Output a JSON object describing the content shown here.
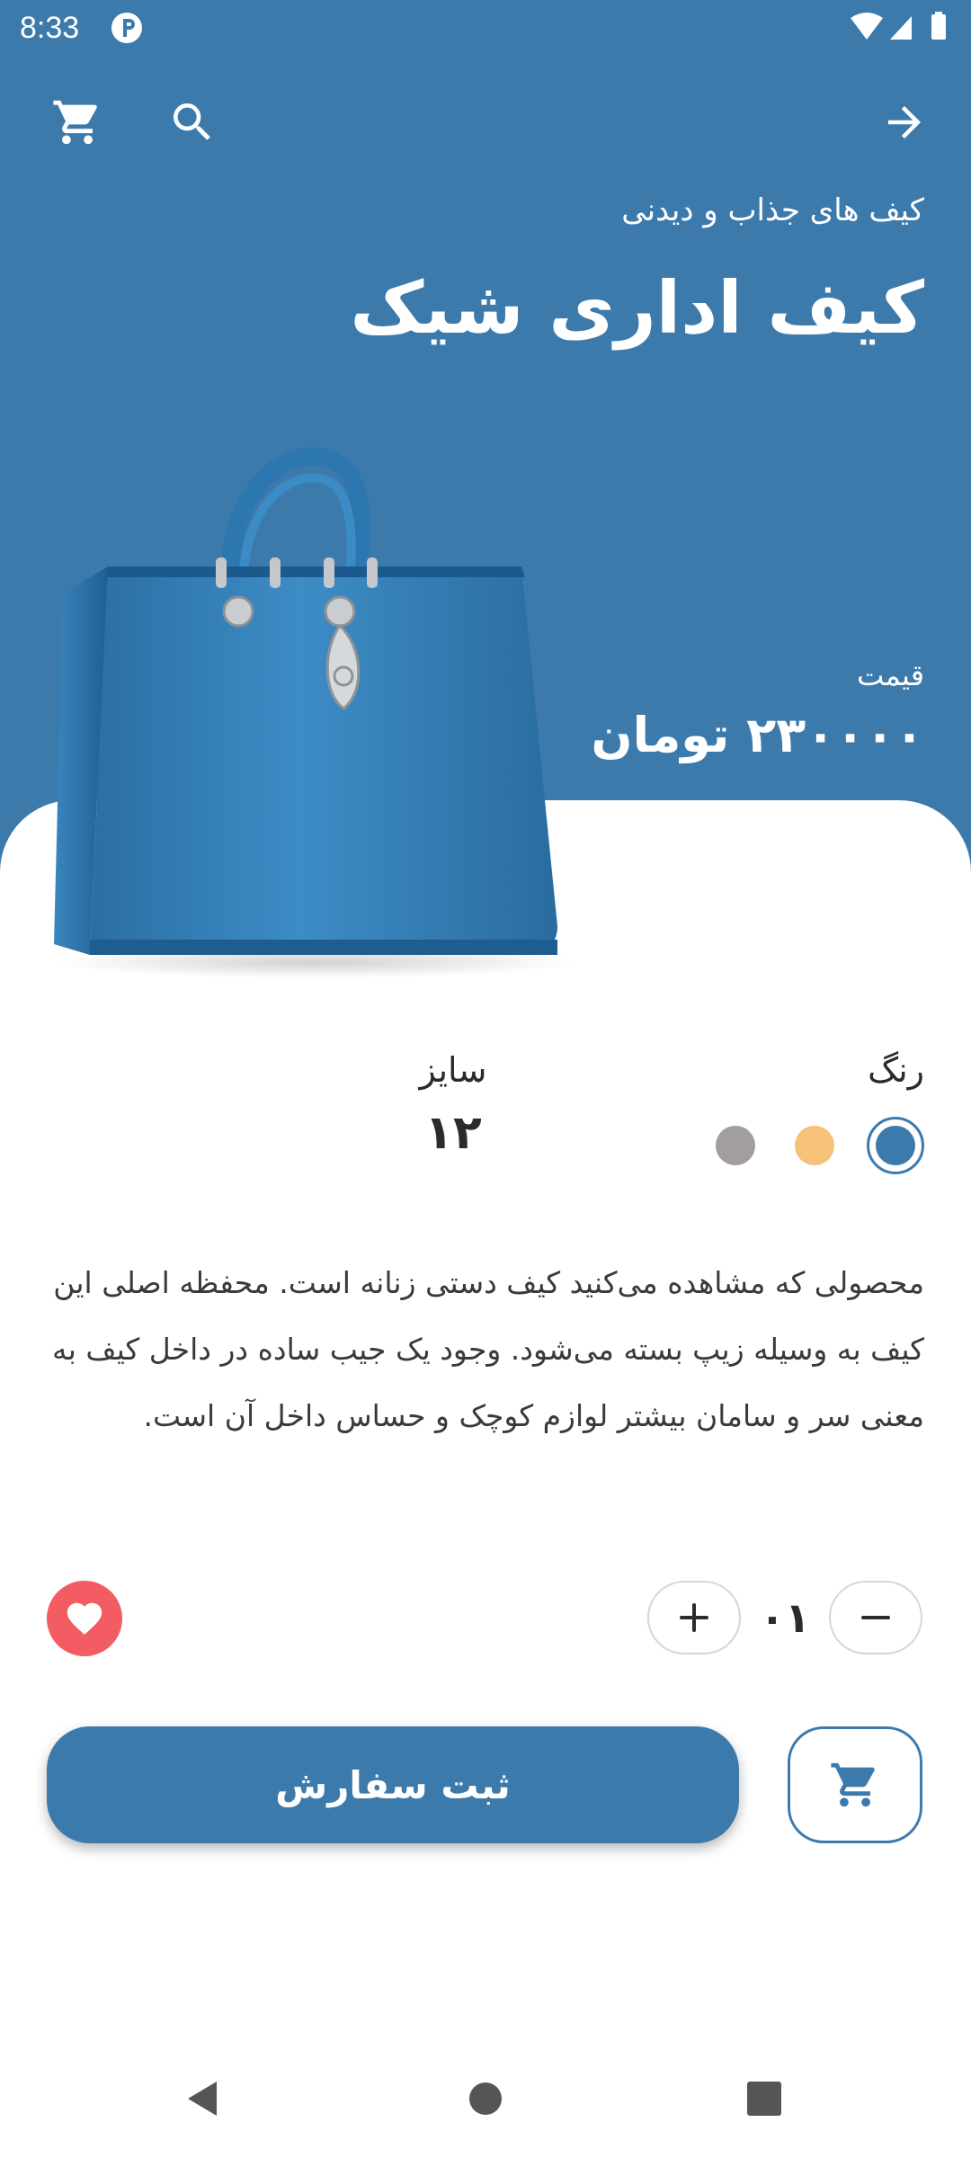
{
  "status_bar": {
    "time": "8:33"
  },
  "header": {
    "subtitle": "کیف های جذاب و دیدنی",
    "title": "کیف اداری شیک"
  },
  "price": {
    "label": "قیمت",
    "value": "۲۳۰۰۰۰ تومان"
  },
  "options": {
    "color_label": "رنگ",
    "colors": [
      "#3d7aac",
      "#f5c277",
      "#a29da0"
    ],
    "size_label": "سایز",
    "size_value": "۱۲"
  },
  "description": "محصولی که مشاهده می‌کنید کیف دستی زنانه است. محفظه اصلی این کیف به وسیله زیپ بسته می‌شود. وجود یک جیب ساده در داخل کیف به معنی سر و سامان بیشتر لوازم کوچک و حساس داخل آن است.",
  "quantity": {
    "value": "۰۱"
  },
  "actions": {
    "submit_label": "ثبت سفارش"
  },
  "colors": {
    "primary": "#3d7aac",
    "favorite": "#f25c62"
  },
  "icons": [
    "cart-icon",
    "search-icon",
    "arrow-right-icon",
    "heart-icon",
    "plus-icon",
    "minus-icon",
    "nav-back-icon",
    "nav-home-icon",
    "nav-recent-icon"
  ]
}
